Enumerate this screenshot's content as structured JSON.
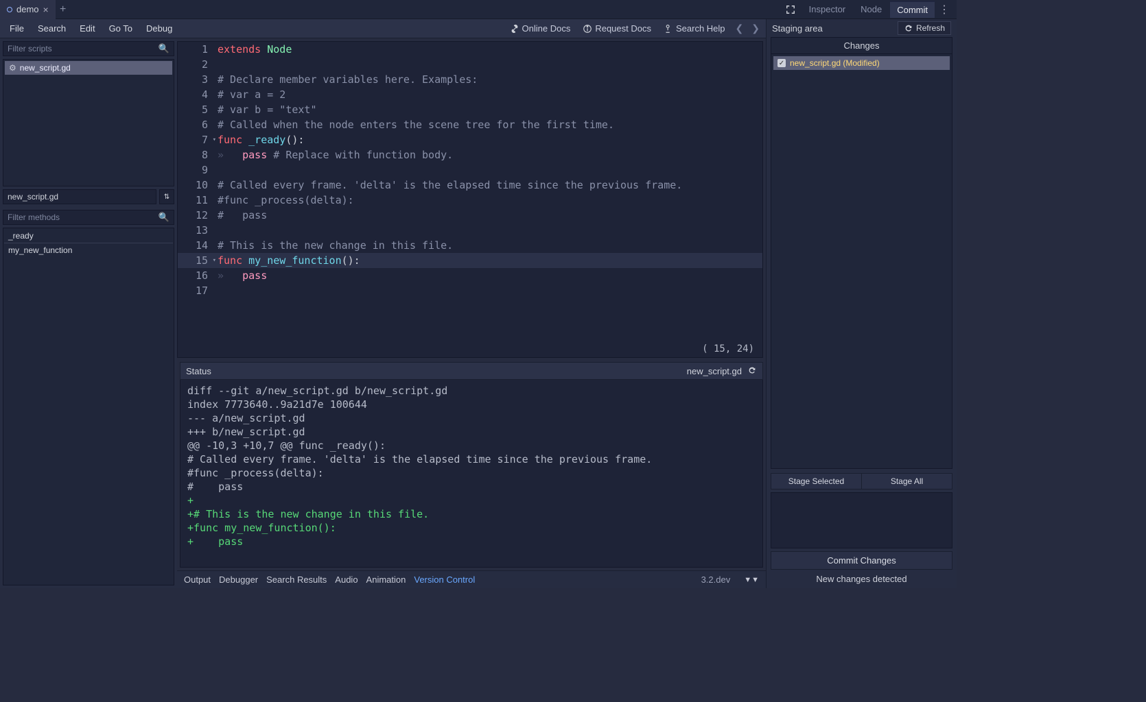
{
  "scene_tab": {
    "name": "demo"
  },
  "right_tabs": [
    "Inspector",
    "Node",
    "Commit"
  ],
  "right_active": 2,
  "menubar": [
    "File",
    "Search",
    "Edit",
    "Go To",
    "Debug"
  ],
  "help_links": [
    "Online Docs",
    "Request Docs",
    "Search Help"
  ],
  "sidebar": {
    "filter_scripts_placeholder": "Filter scripts",
    "script_item": "new_script.gd",
    "script_path": "new_script.gd",
    "filter_methods_placeholder": "Filter methods",
    "methods": [
      "_ready",
      "my_new_function"
    ]
  },
  "editor": {
    "cursor": "(  15, 24)",
    "lines": [
      {
        "n": 1,
        "seg": [
          [
            "kw",
            "extends"
          ],
          [
            "",
            " "
          ],
          [
            "cls",
            "Node"
          ]
        ]
      },
      {
        "n": 2,
        "seg": []
      },
      {
        "n": 3,
        "seg": [
          [
            "cmt",
            "# Declare member variables here. Examples:"
          ]
        ]
      },
      {
        "n": 4,
        "seg": [
          [
            "cmt",
            "# var a = 2"
          ]
        ]
      },
      {
        "n": 5,
        "seg": [
          [
            "cmt",
            "# var b = \"text\""
          ]
        ]
      },
      {
        "n": 6,
        "seg": [
          [
            "cmt",
            "# Called when the node enters the scene tree for the first time."
          ]
        ]
      },
      {
        "n": 7,
        "fold": true,
        "seg": [
          [
            "kw",
            "func"
          ],
          [
            "",
            " "
          ],
          [
            "fn",
            "_ready"
          ],
          [
            "",
            "():"
          ]
        ]
      },
      {
        "n": 8,
        "tab": true,
        "seg": [
          [
            "kw2",
            "pass"
          ],
          [
            "",
            " "
          ],
          [
            "cmt",
            "# Replace with function body."
          ]
        ]
      },
      {
        "n": 9,
        "seg": []
      },
      {
        "n": 10,
        "seg": [
          [
            "cmt",
            "# Called every frame. 'delta' is the elapsed time since the previous frame."
          ]
        ]
      },
      {
        "n": 11,
        "seg": [
          [
            "cmt",
            "#func _process(delta):"
          ]
        ]
      },
      {
        "n": 12,
        "seg": [
          [
            "cmt",
            "#   pass"
          ]
        ]
      },
      {
        "n": 13,
        "seg": []
      },
      {
        "n": 14,
        "seg": [
          [
            "cmt",
            "# This is the new change in this file."
          ]
        ]
      },
      {
        "n": 15,
        "fold": true,
        "active": true,
        "seg": [
          [
            "kw",
            "func"
          ],
          [
            "",
            " "
          ],
          [
            "fn",
            "my_new_function"
          ],
          [
            "",
            "():"
          ]
        ]
      },
      {
        "n": 16,
        "tab": true,
        "seg": [
          [
            "kw2",
            "pass"
          ]
        ]
      },
      {
        "n": 17,
        "seg": []
      }
    ]
  },
  "diff": {
    "header_label": "Status",
    "file": "new_script.gd",
    "lines": [
      {
        "c": "",
        "t": "diff --git a/new_script.gd b/new_script.gd"
      },
      {
        "c": "",
        "t": "index 7773640..9a21d7e 100644"
      },
      {
        "c": "",
        "t": "--- a/new_script.gd"
      },
      {
        "c": "",
        "t": "+++ b/new_script.gd"
      },
      {
        "c": "",
        "t": "@@ -10,3 +10,7 @@ func _ready():"
      },
      {
        "c": "",
        "t": "# Called every frame. 'delta' is the elapsed time since the previous frame."
      },
      {
        "c": "",
        "t": "#func _process(delta):"
      },
      {
        "c": "",
        "t": "#    pass"
      },
      {
        "c": "add",
        "t": "+"
      },
      {
        "c": "add",
        "t": "+# This is the new change in this file."
      },
      {
        "c": "add",
        "t": "+func my_new_function():"
      },
      {
        "c": "add",
        "t": "+    pass"
      }
    ]
  },
  "bottom_tabs": [
    "Output",
    "Debugger",
    "Search Results",
    "Audio",
    "Animation",
    "Version Control"
  ],
  "bottom_active": 5,
  "version_label": "3.2.dev",
  "commit_panel": {
    "staging_label": "Staging area",
    "refresh_label": "Refresh",
    "changes_title": "Changes",
    "changed_file": "new_script.gd (Modified)",
    "stage_selected": "Stage Selected",
    "stage_all": "Stage All",
    "commit_button": "Commit Changes",
    "status_text": "New changes detected"
  }
}
